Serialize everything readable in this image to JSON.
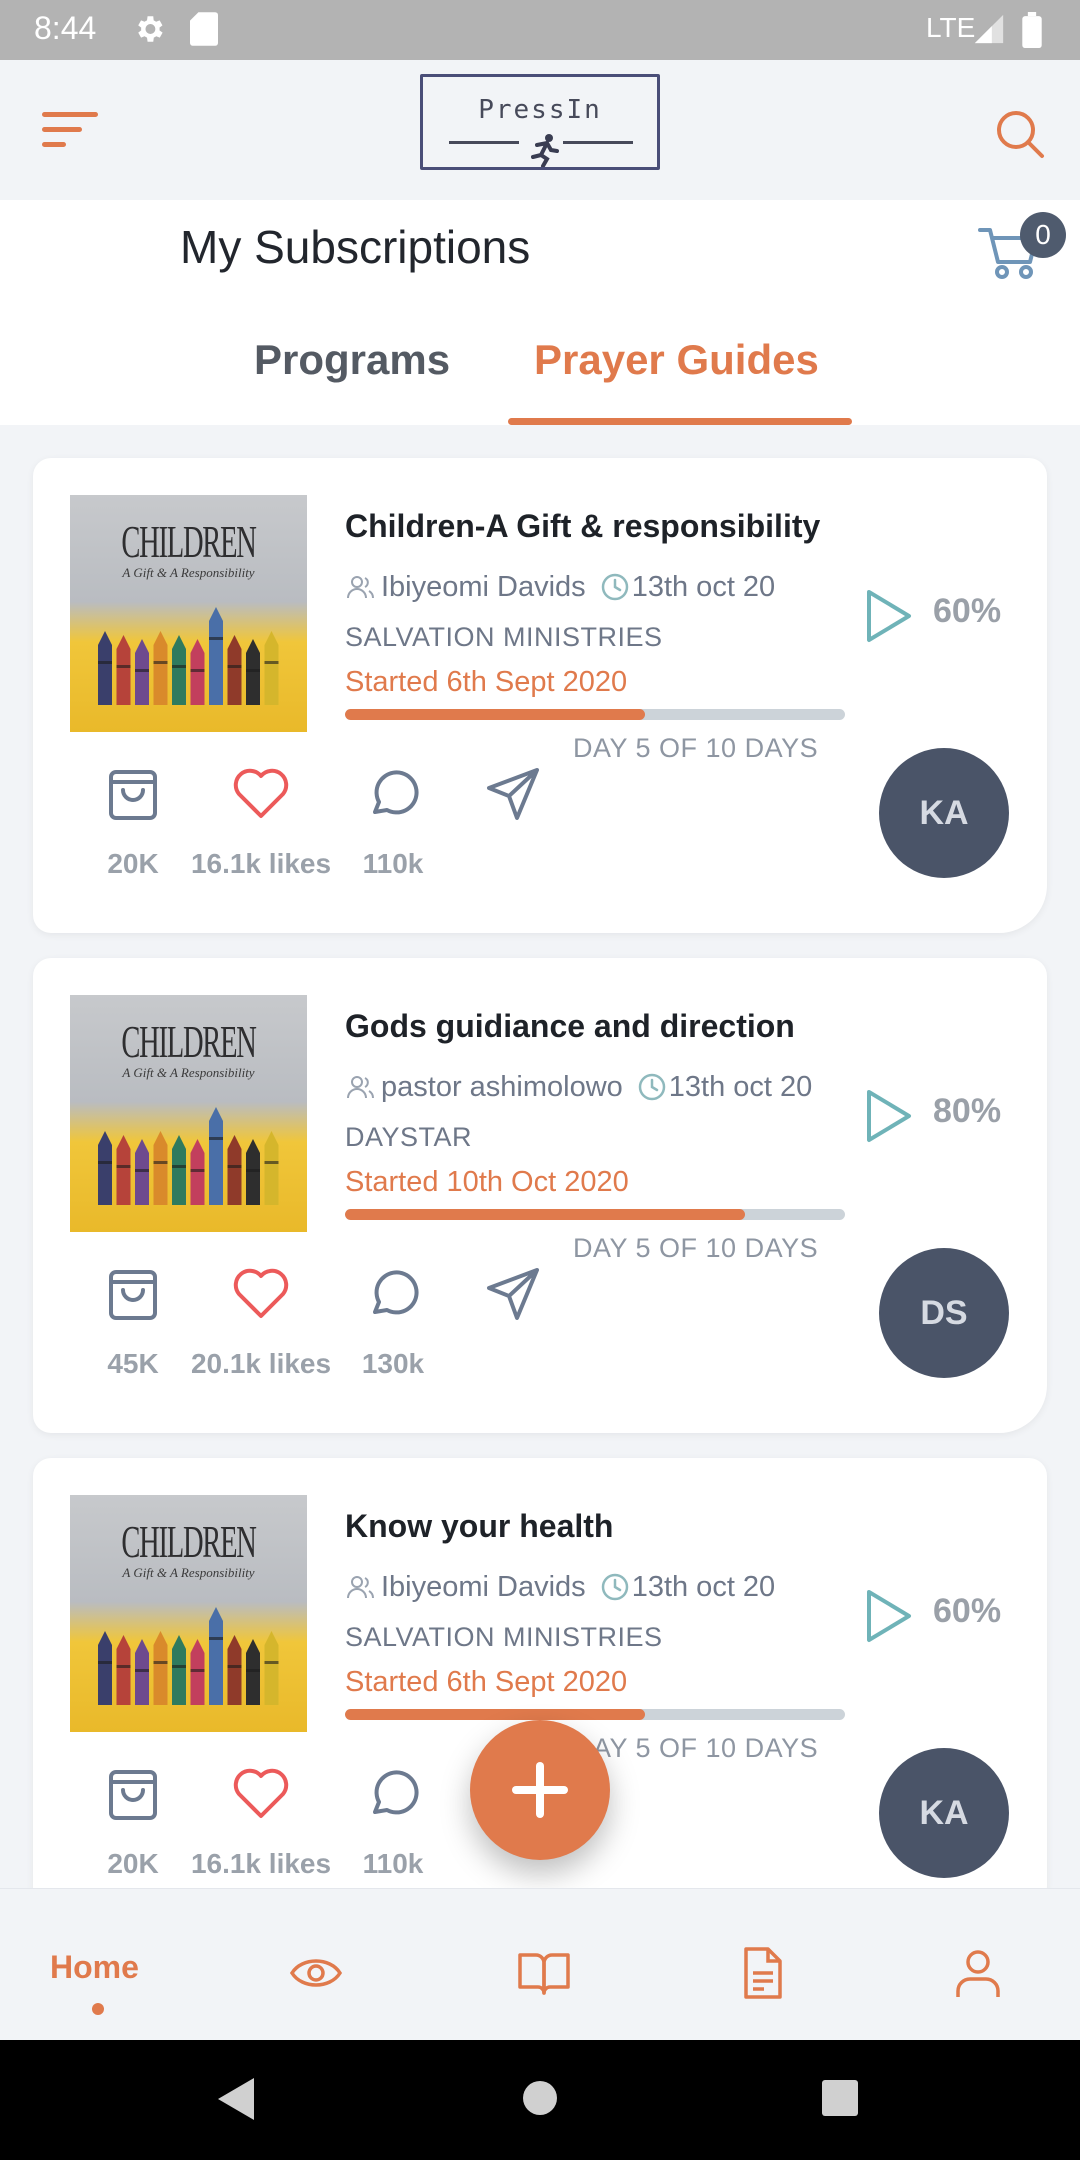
{
  "status_bar": {
    "time": "8:44",
    "network": "LTE"
  },
  "header": {
    "logo_text": "PressIn",
    "menu_icon": "menu-icon",
    "search_icon": "search-icon"
  },
  "page": {
    "title": "My Subscriptions",
    "cart_count": "0",
    "tabs": [
      {
        "label": "Programs",
        "active": false
      },
      {
        "label": "Prayer Guides",
        "active": true
      }
    ]
  },
  "cards": [
    {
      "cover_title": "CHILDREN",
      "cover_subtitle": "A Gift & A Responsibility",
      "title": "Children-A Gift & responsibility",
      "author": "Ibiyeomi Davids",
      "date": "13th oct 20",
      "organization": "SALVATION MINISTRIES",
      "started": "Started 6th Sept 2020",
      "progress": 0.6,
      "day_label": "DAY 5 OF 10 DAYS",
      "percent": "60%",
      "purchases": "20K",
      "likes": "16.1k likes",
      "comments": "110k",
      "avatar_initials": "KA"
    },
    {
      "cover_title": "CHILDREN",
      "cover_subtitle": "A Gift & A Responsibility",
      "title": "Gods guidiance and direction",
      "author": "pastor ashimolowo",
      "date": "13th oct 20",
      "organization": "DAYSTAR",
      "started": "Started 10th Oct 2020",
      "progress": 0.8,
      "day_label": "DAY 5 OF 10 DAYS",
      "percent": "80%",
      "purchases": "45K",
      "likes": "20.1k likes",
      "comments": "130k",
      "avatar_initials": "DS"
    },
    {
      "cover_title": "CHILDREN",
      "cover_subtitle": "A Gift & A Responsibility",
      "title": "Know your health",
      "author": "Ibiyeomi Davids",
      "date": "13th oct 20",
      "organization": "SALVATION MINISTRIES",
      "started": "Started 6th Sept 2020",
      "progress": 0.6,
      "day_label": "DAY 5 OF 10 DAYS",
      "percent": "60%",
      "purchases": "20K",
      "likes": "16.1k likes",
      "comments": "110k",
      "avatar_initials": "KA"
    }
  ],
  "bottom_nav": {
    "home_label": "Home",
    "items": [
      "home",
      "eye-icon",
      "book-icon",
      "document-icon",
      "profile-icon"
    ]
  },
  "colors": {
    "accent": "#e07a4c",
    "avatar": "#4a5468",
    "progress_track": "#ccd3d9",
    "play": "#6fb3b8"
  }
}
